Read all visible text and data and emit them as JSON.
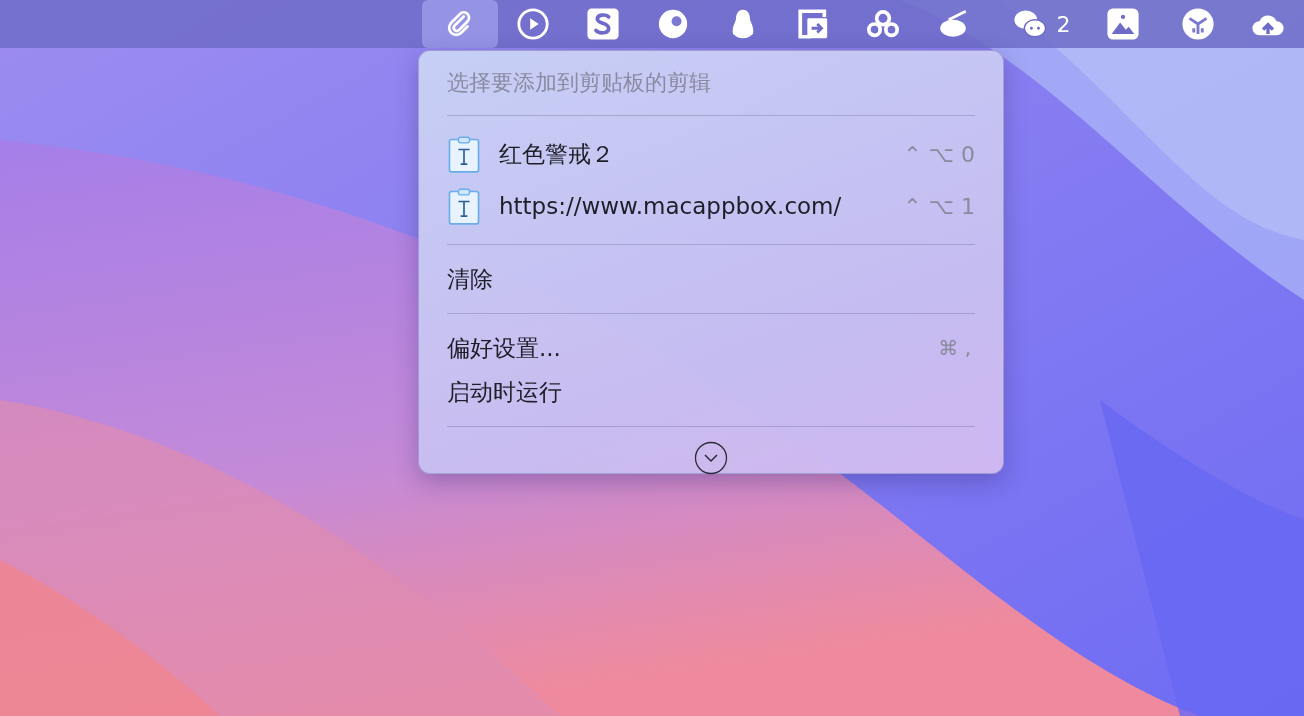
{
  "menu_bar": {
    "items": [
      {
        "selected": true
      },
      {
        "selected": false
      },
      {
        "selected": false
      },
      {
        "selected": false
      },
      {
        "selected": false
      },
      {
        "selected": false
      },
      {
        "selected": false
      },
      {
        "selected": false
      },
      {
        "selected": false,
        "badge": "2"
      },
      {
        "selected": false
      },
      {
        "selected": false
      },
      {
        "selected": false
      }
    ]
  },
  "menu": {
    "header": "选择要添加到剪贴板的剪辑",
    "clips": [
      {
        "text": "红色警戒２",
        "shortcut": "⌃ ⌥ 0"
      },
      {
        "text": "https://www.macappbox.com/",
        "shortcut": "⌃ ⌥ 1"
      }
    ],
    "clear": "清除",
    "preferences": {
      "label": "偏好设置...",
      "shortcut": "⌘ ,"
    },
    "launch_at_login": "启动时运行"
  }
}
